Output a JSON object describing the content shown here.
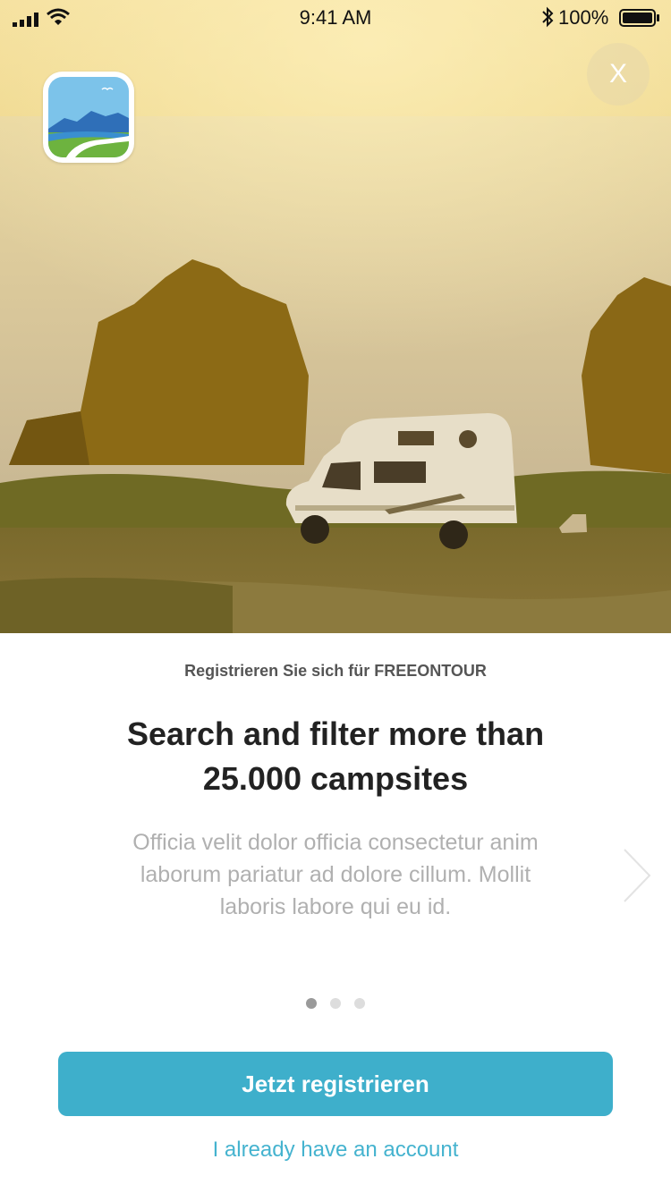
{
  "status_bar": {
    "time": "9:41 AM",
    "battery": "100%",
    "icons": [
      "signal-icon",
      "wifi-icon",
      "bluetooth-icon",
      "battery-icon"
    ]
  },
  "close_button": {
    "label": "X"
  },
  "hero": {
    "image_icon": "camper-van-sunset-photo"
  },
  "content": {
    "subtitle": "Registrieren Sie sich für FREEONTOUR",
    "headline_line1": "Search and filter more than",
    "headline_line2": "25.000 campsites",
    "body": "Officia velit dolor officia consectetur anim laborum pariatur ad dolore cillum. Mollit laboris labore qui eu id."
  },
  "pagination": {
    "total": 3,
    "active_index": 0
  },
  "actions": {
    "register": "Jetzt registrieren",
    "login": "I already have an account"
  },
  "colors": {
    "accent": "#3eafcb",
    "link": "#45b3cf",
    "headline": "#222222",
    "body": "#b0b0b0"
  }
}
